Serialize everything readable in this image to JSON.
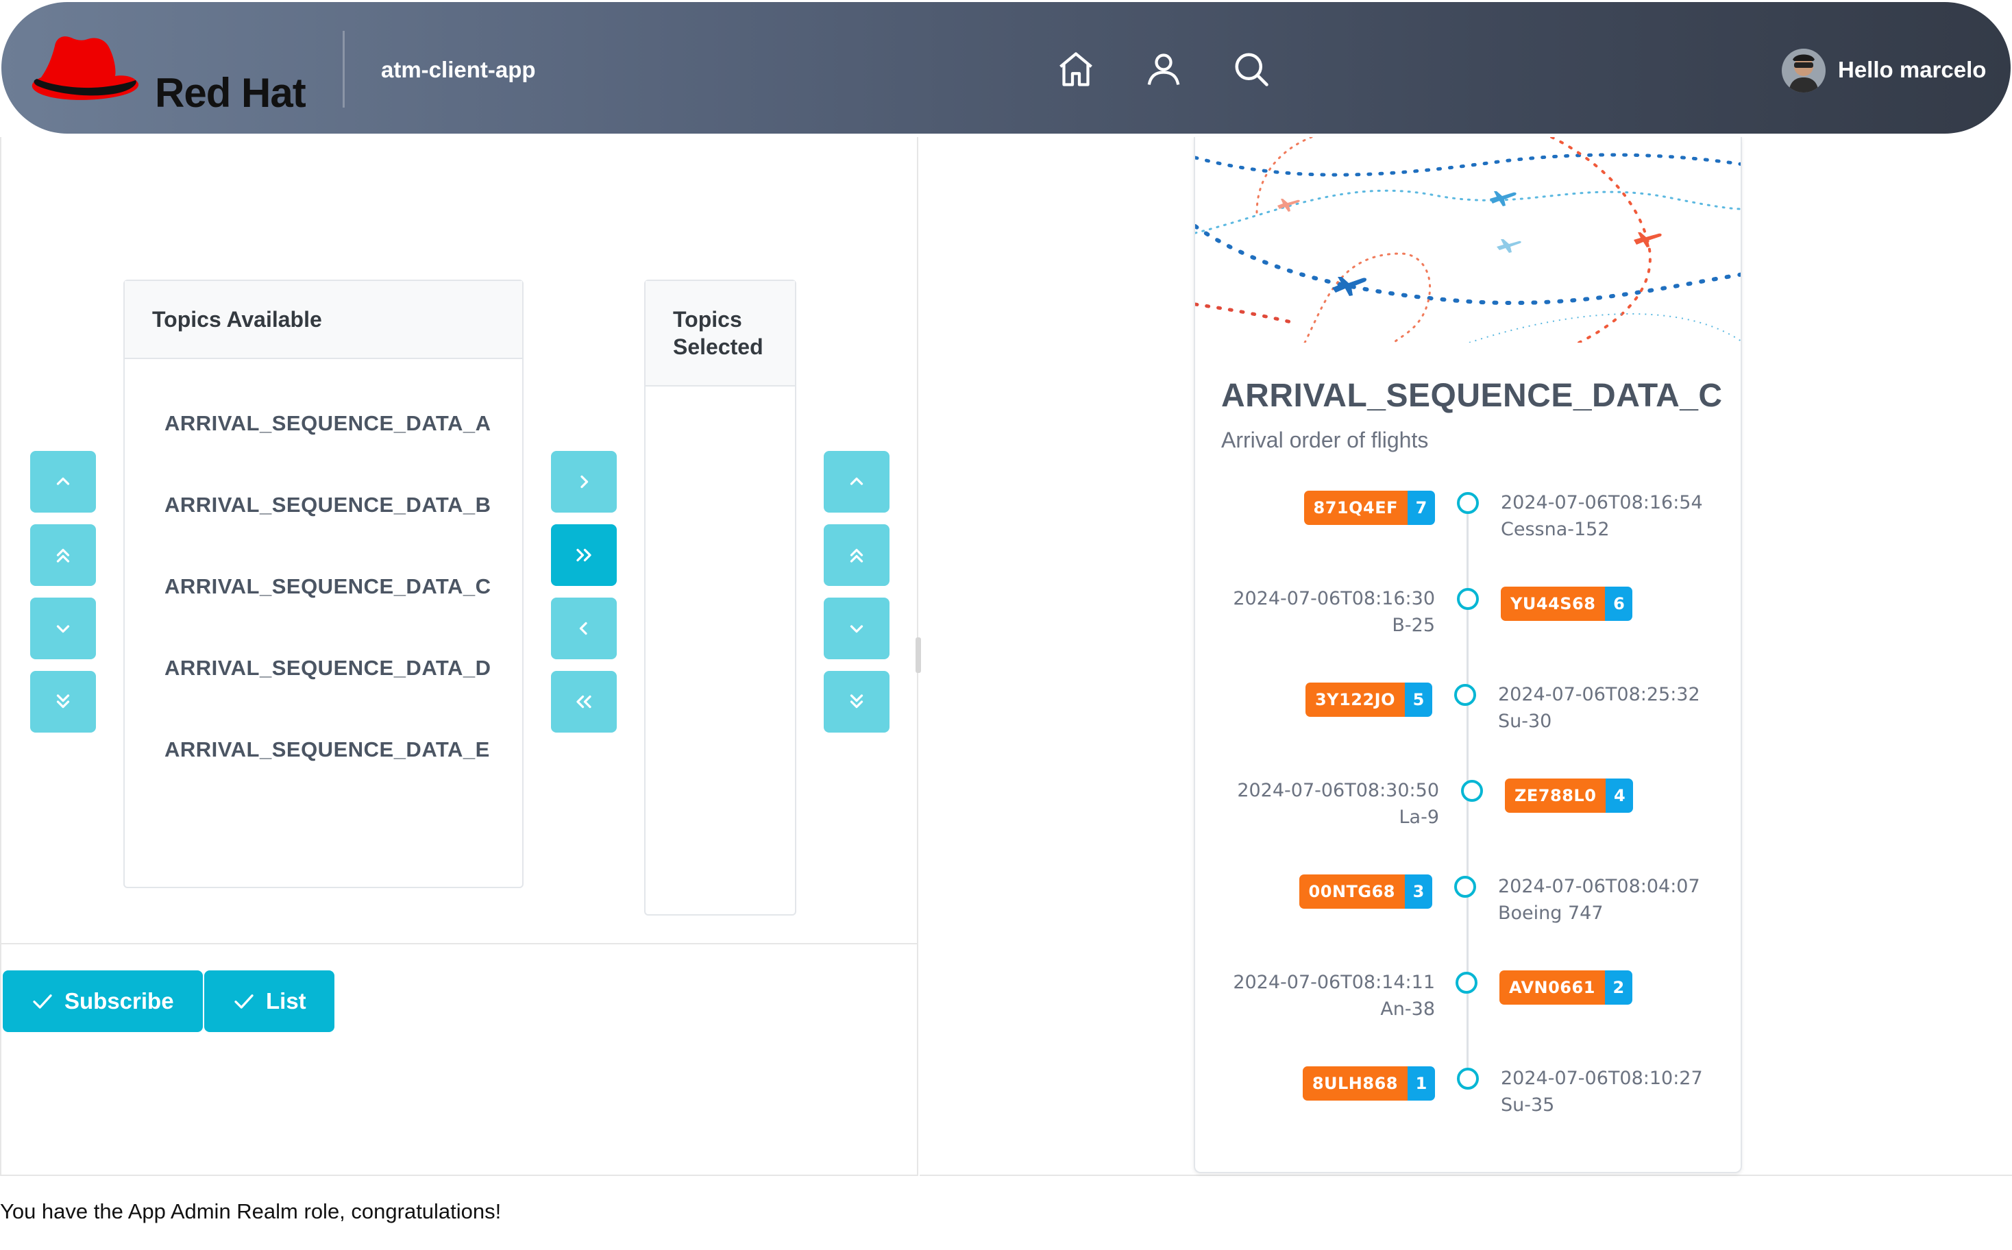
{
  "header": {
    "brand": "Red Hat",
    "app_name": "atm-client-app",
    "nav_icons": [
      "home-icon",
      "user-icon",
      "search-icon"
    ],
    "greeting": "Hello marcelo",
    "colors": {
      "brand_red": "#ee0000",
      "header_start": "#6d7d95",
      "header_end": "#343b48"
    }
  },
  "picklist": {
    "source_header": "Topics Available",
    "target_header": "Topics Selected",
    "source_items": [
      "ARRIVAL_SEQUENCE_DATA_A",
      "ARRIVAL_SEQUENCE_DATA_B",
      "ARRIVAL_SEQUENCE_DATA_C",
      "ARRIVAL_SEQUENCE_DATA_D",
      "ARRIVAL_SEQUENCE_DATA_E"
    ],
    "target_items": [],
    "accent_color": "#06b6d4"
  },
  "actions": {
    "subscribe_label": "Subscribe",
    "list_label": "List"
  },
  "card": {
    "title": "ARRIVAL_SEQUENCE_DATA_C",
    "subtitle": "Arrival order of flights",
    "timeline": [
      {
        "code": "871Q4EF",
        "seq": "7",
        "time": "2024-07-06T08:16:54",
        "aircraft": "Cessna-152"
      },
      {
        "code": "YU44S68",
        "seq": "6",
        "time": "2024-07-06T08:16:30",
        "aircraft": "B-25"
      },
      {
        "code": "3Y122JO",
        "seq": "5",
        "time": "2024-07-06T08:25:32",
        "aircraft": "Su-30"
      },
      {
        "code": "ZE788L0",
        "seq": "4",
        "time": "2024-07-06T08:30:50",
        "aircraft": "La-9"
      },
      {
        "code": "00NTG68",
        "seq": "3",
        "time": "2024-07-06T08:04:07",
        "aircraft": "Boeing 747"
      },
      {
        "code": "AVN0661",
        "seq": "2",
        "time": "2024-07-06T08:14:11",
        "aircraft": "An-38"
      },
      {
        "code": "8ULH868",
        "seq": "1",
        "time": "2024-07-06T08:10:27",
        "aircraft": "Su-35"
      }
    ]
  },
  "footer": {
    "message": "You have the App Admin Realm role, congratulations!"
  }
}
